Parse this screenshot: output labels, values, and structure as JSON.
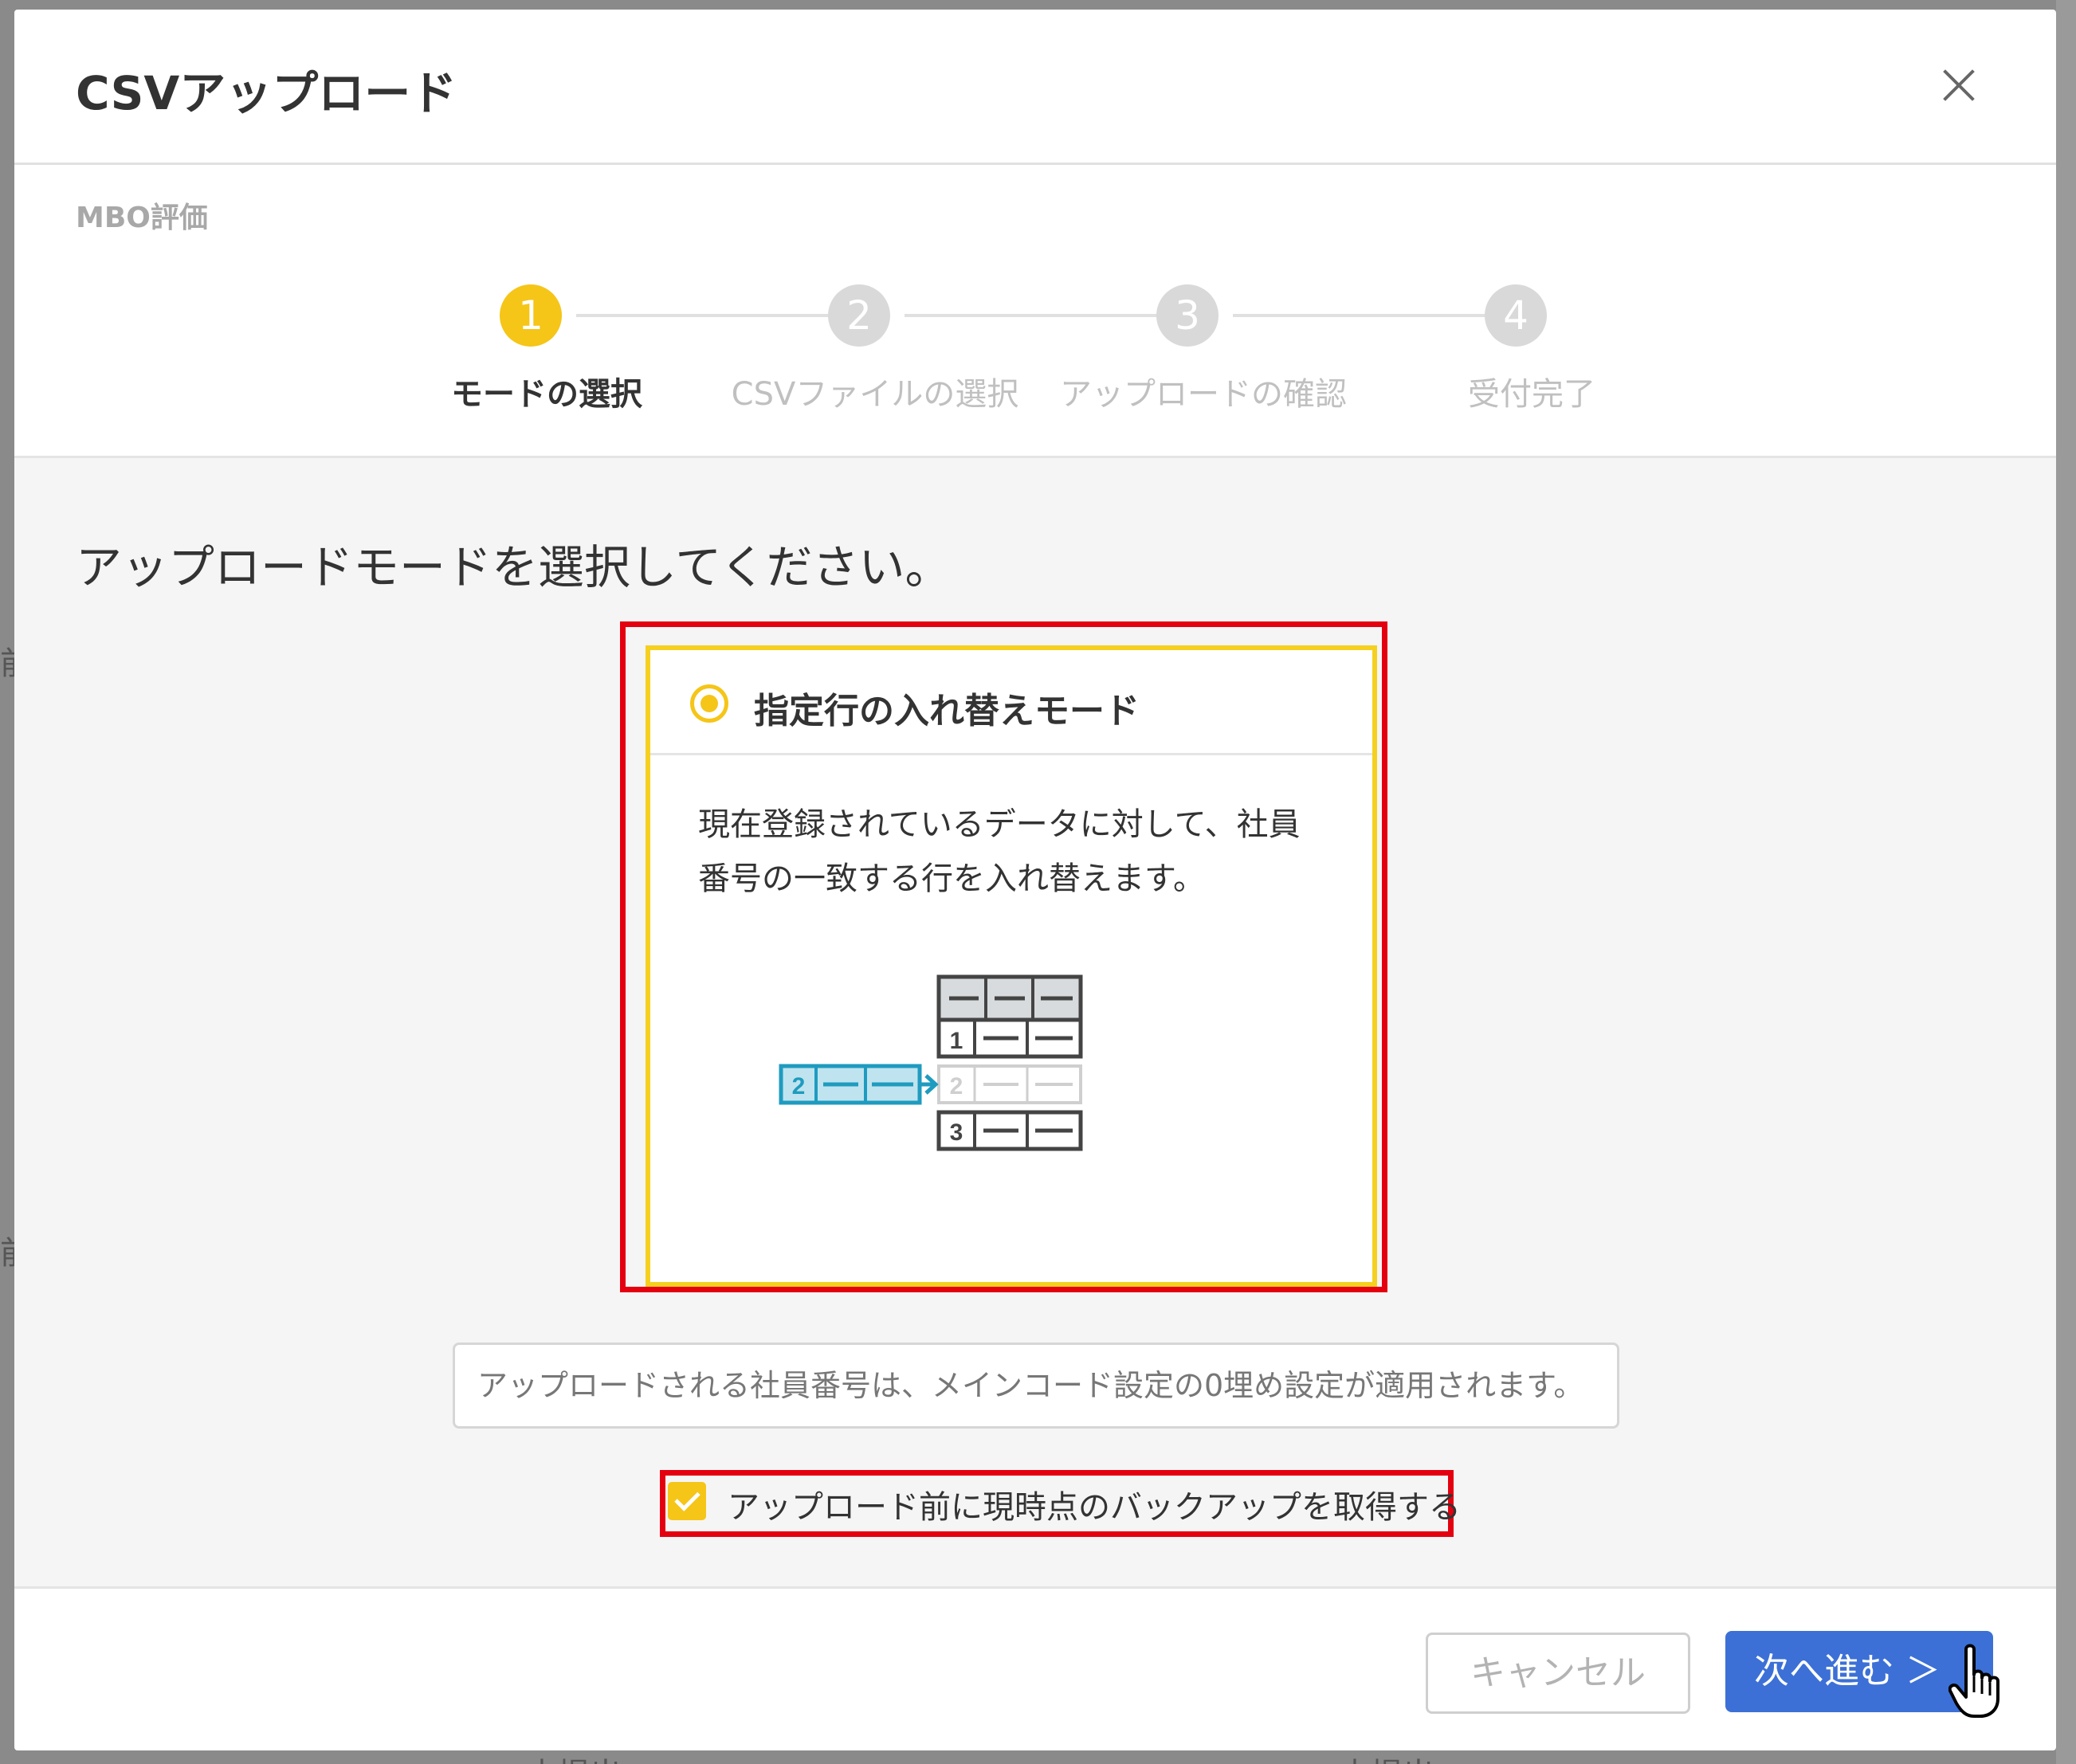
{
  "background": {
    "side_chars": [
      "前",
      "前"
    ],
    "bottom_texts": [
      "ー　未提出",
      "ー　未提出"
    ]
  },
  "dialog": {
    "title": "CSVアップロード",
    "close_icon": "close-icon",
    "section": "MBO評価"
  },
  "stepper": {
    "steps": [
      {
        "number": "1",
        "label": "モードの選択",
        "state": "active"
      },
      {
        "number": "2",
        "label": "CSVファイルの選択",
        "state": "inactive"
      },
      {
        "number": "3",
        "label": "アップロードの確認",
        "state": "inactive"
      },
      {
        "number": "4",
        "label": "受付完了",
        "state": "inactive"
      }
    ],
    "active_color": "#f5c518",
    "inactive_color": "#d9d9d9"
  },
  "body": {
    "instruction": "アップロードモードを選択してください。",
    "mode_card": {
      "title": "指定行の入れ替えモード",
      "selected": true,
      "description": "現在登録されているデータに対して、社員番号の一致する行を入れ替えます。",
      "illustration": {
        "incoming_row": "2",
        "table_rows": [
          "1",
          "2",
          "3"
        ],
        "replaced_row": "2"
      }
    },
    "note": "アップロードされる社員番号は、メインコード設定の0埋め設定が適用されます。",
    "backup": {
      "checked": true,
      "label": "アップロード前に現時点のバックアップを取得する"
    },
    "highlight_color": "#e4000f"
  },
  "footer": {
    "cancel_label": "キャンセル",
    "next_label": "次へ進む ＞"
  },
  "colors": {
    "accent_yellow": "#f5c518",
    "primary_blue": "#3c70d6",
    "illustration_teal": "#1f9bbf"
  }
}
